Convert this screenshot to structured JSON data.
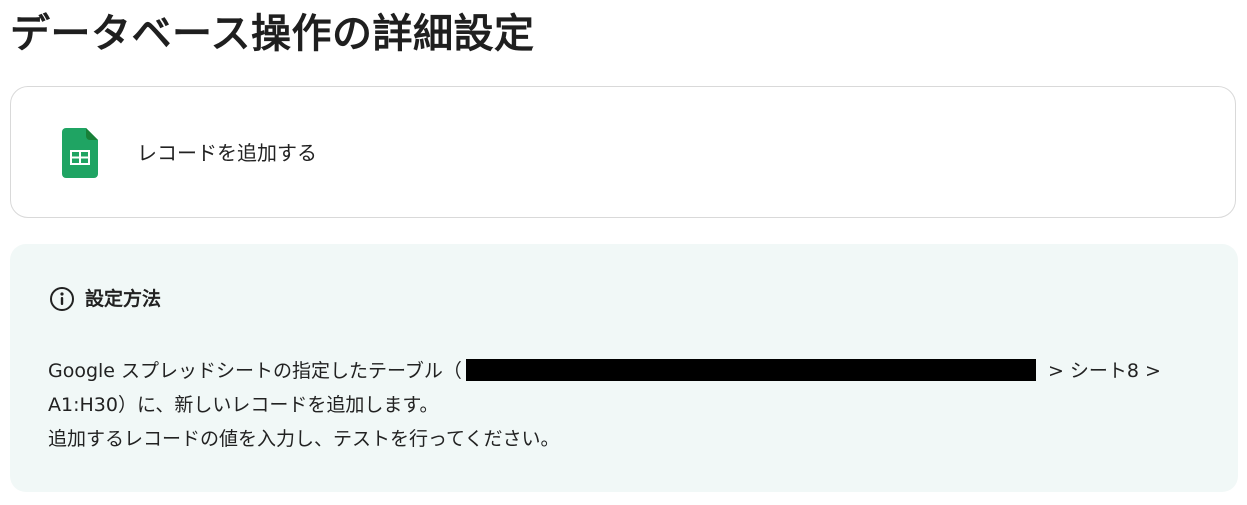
{
  "page": {
    "title": "データベース操作の詳細設定"
  },
  "action": {
    "icon": "google-sheets-icon",
    "label": "レコードを追加する"
  },
  "info": {
    "icon": "info-circle-icon",
    "title": "設定方法",
    "line1_prefix": "Google スプレッドシートの指定したテーブル（",
    "line1_suffix": " > シート8 >",
    "line2": "A1:H30）に、新しいレコードを追加します。",
    "line3": "追加するレコードの値を入力し、テストを行ってください。"
  },
  "colors": {
    "sheets_green": "#1fa463",
    "info_background": "#f1f8f7",
    "card_border": "#d9d9d9"
  }
}
